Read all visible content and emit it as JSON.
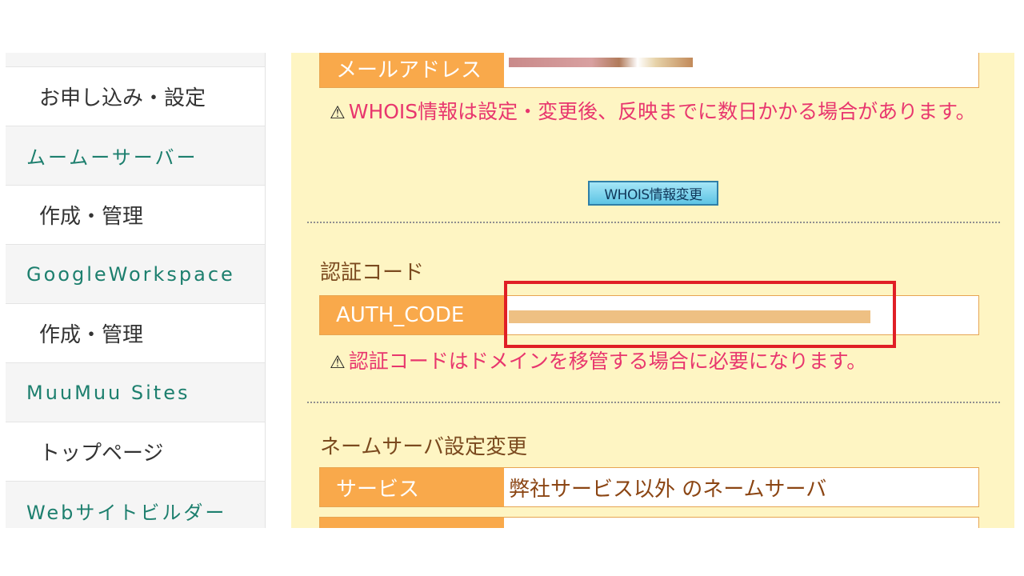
{
  "sidebar": {
    "items": [
      {
        "label": "お申し込み・設定",
        "kind": "sub"
      },
      {
        "label": "ムームーサーバー",
        "kind": "head"
      },
      {
        "label": "作成・管理",
        "kind": "sub"
      },
      {
        "label": "GoogleWorkspace",
        "kind": "head"
      },
      {
        "label": "作成・管理",
        "kind": "sub"
      },
      {
        "label": "MuuMuu Sites",
        "kind": "head"
      },
      {
        "label": "トップページ",
        "kind": "sub"
      },
      {
        "label": "Webサイトビルダー",
        "kind": "head"
      }
    ]
  },
  "main": {
    "email_row": {
      "label": "メールアドレス"
    },
    "whois_notice": "WHOIS情報は設定・変更後、反映までに数日かかる場合があります。",
    "whois_button": "WHOIS情報変更",
    "auth_section": {
      "title": "認証コード",
      "label": "AUTH_CODE",
      "notice": "認証コードはドメインを移管する場合に必要になります。"
    },
    "ns_section": {
      "title": "ネームサーバ設定変更",
      "service_label": "サービス",
      "service_value": "弊社サービス以外 のネームサーバ"
    }
  },
  "colors": {
    "panel_bg": "#fef5c3",
    "label_bg": "#f9a94b",
    "notice_text": "#e8366e",
    "highlight": "#e01f26",
    "sidebar_heading": "#1d7f6e"
  },
  "icons": {
    "warning": "warning-triangle-icon"
  }
}
